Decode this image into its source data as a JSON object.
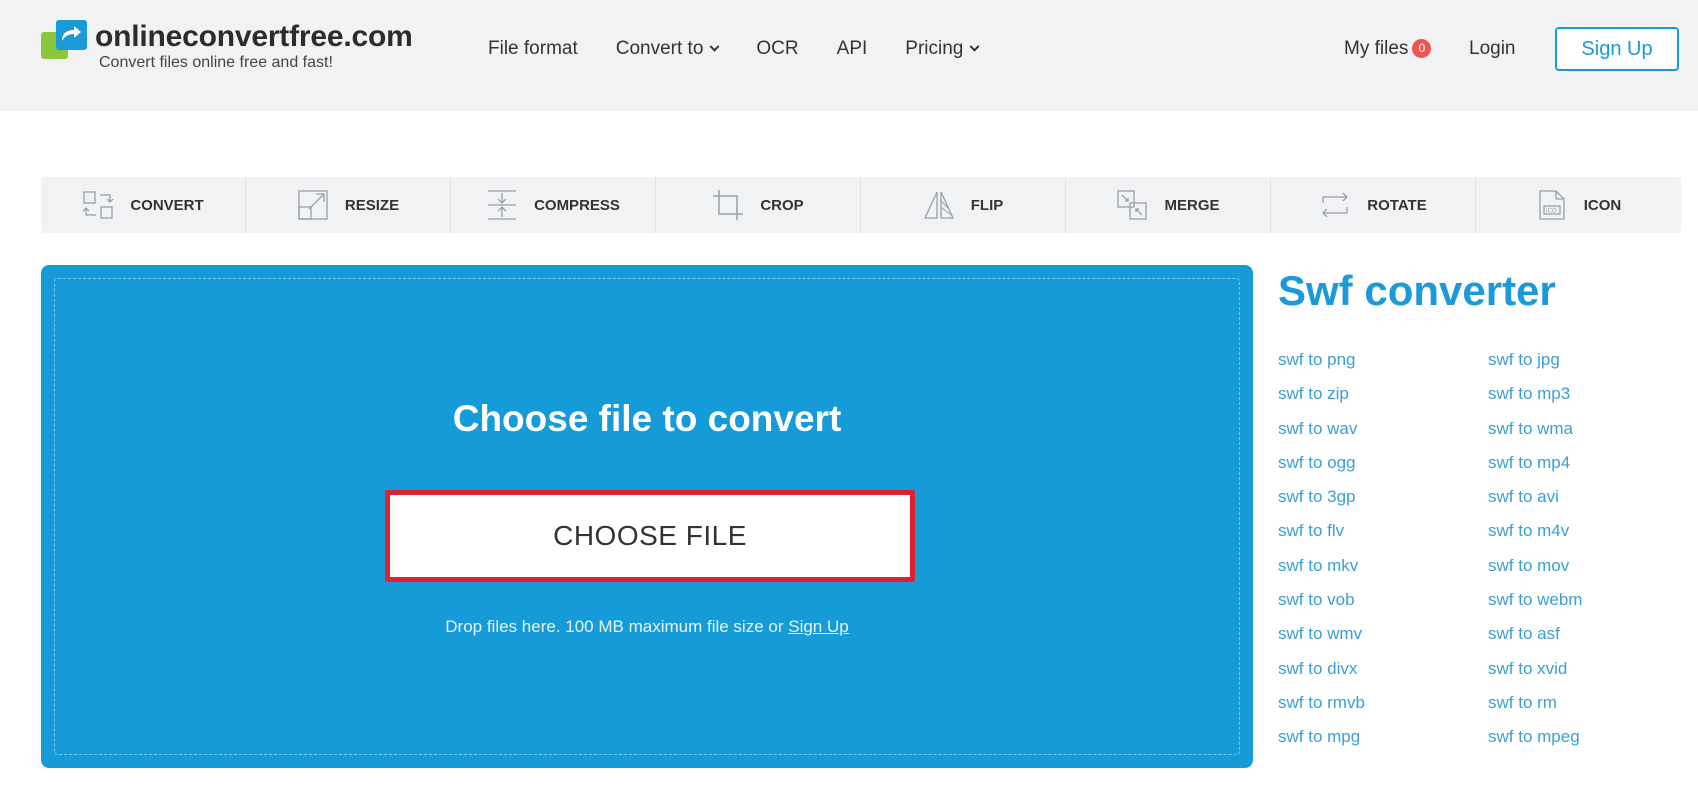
{
  "header": {
    "logo_title": "onlineconvertfree.com",
    "logo_subtitle": "Convert files online free and fast!",
    "nav": [
      {
        "label": "File format",
        "dropdown": false
      },
      {
        "label": "Convert to",
        "dropdown": true
      },
      {
        "label": "OCR",
        "dropdown": false
      },
      {
        "label": "API",
        "dropdown": false
      },
      {
        "label": "Pricing",
        "dropdown": true
      }
    ],
    "my_files_label": "My files",
    "my_files_count": "0",
    "login_label": "Login",
    "signup_label": "Sign Up"
  },
  "tools": [
    {
      "label": "CONVERT",
      "icon": "convert-icon"
    },
    {
      "label": "RESIZE",
      "icon": "resize-icon"
    },
    {
      "label": "COMPRESS",
      "icon": "compress-icon"
    },
    {
      "label": "CROP",
      "icon": "crop-icon"
    },
    {
      "label": "FLIP",
      "icon": "flip-icon"
    },
    {
      "label": "MERGE",
      "icon": "merge-icon"
    },
    {
      "label": "ROTATE",
      "icon": "rotate-icon"
    },
    {
      "label": "ICON",
      "icon": "ico-file-icon"
    }
  ],
  "upload": {
    "title": "Choose file to convert",
    "button_label": "CHOOSE FILE",
    "drop_text": "Drop files here. 100 MB maximum file size or",
    "signup_link": "Sign Up"
  },
  "sidebar": {
    "title": "Swf converter",
    "links": [
      "swf to png",
      "swf to jpg",
      "swf to zip",
      "swf to mp3",
      "swf to wav",
      "swf to wma",
      "swf to ogg",
      "swf to mp4",
      "swf to 3gp",
      "swf to avi",
      "swf to flv",
      "swf to m4v",
      "swf to mkv",
      "swf to mov",
      "swf to vob",
      "swf to webm",
      "swf to wmv",
      "swf to asf",
      "swf to divx",
      "swf to xvid",
      "swf to rmvb",
      "swf to rm",
      "swf to mpg",
      "swf to mpeg"
    ]
  },
  "colors": {
    "brand_blue": "#1a9ad9",
    "panel_blue": "#159cd8",
    "highlight_red": "#e02030",
    "badge_red": "#f0544f"
  }
}
